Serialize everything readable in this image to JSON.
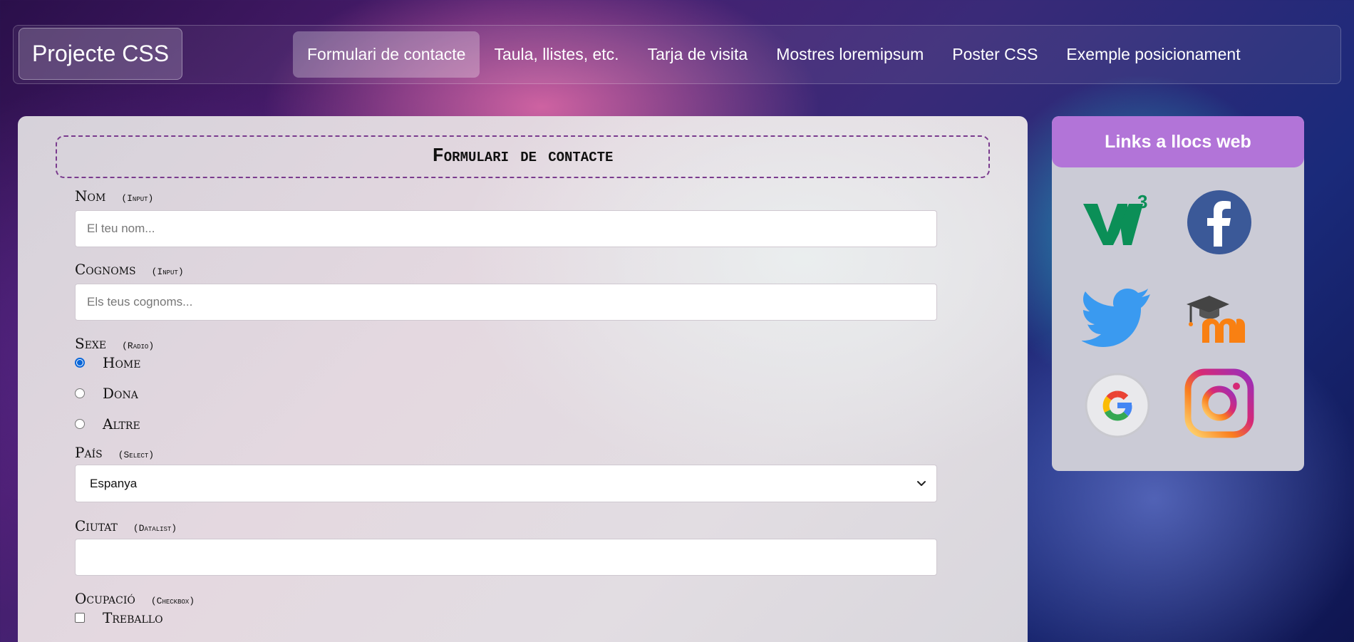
{
  "nav": {
    "brand": "Projecte CSS",
    "items": [
      {
        "label": "Formulari de contacte",
        "active": true
      },
      {
        "label": "Taula, llistes, etc.",
        "active": false
      },
      {
        "label": "Tarja de visita",
        "active": false
      },
      {
        "label": "Mostres loremipsum",
        "active": false
      },
      {
        "label": "Poster CSS",
        "active": false
      },
      {
        "label": "Exemple posicionament",
        "active": false
      }
    ]
  },
  "form": {
    "title": "Formulari de contacte",
    "nom": {
      "label": "Nom",
      "hint": "(Input)",
      "placeholder": "El teu nom...",
      "value": ""
    },
    "cognoms": {
      "label": "Cognoms",
      "hint": "(Input)",
      "placeholder": "Els teus cognoms...",
      "value": ""
    },
    "sexe": {
      "label": "Sexe",
      "hint": "(Radio)",
      "options": [
        {
          "label": "Home",
          "checked": true
        },
        {
          "label": "Dona",
          "checked": false
        },
        {
          "label": "Altre",
          "checked": false
        }
      ]
    },
    "pais": {
      "label": "País",
      "hint": "(Select)",
      "selected": "Espanya"
    },
    "ciutat": {
      "label": "Ciutat",
      "hint": "(Datalist)",
      "value": ""
    },
    "ocupacio": {
      "label": "Ocupació",
      "hint": "(Checkbox)",
      "options": [
        {
          "label": "Treballo",
          "checked": false
        }
      ]
    }
  },
  "sidebar": {
    "title": "Links a llocs web",
    "links": [
      {
        "icon": "w3c-icon"
      },
      {
        "icon": "facebook-icon"
      },
      {
        "icon": "twitter-icon"
      },
      {
        "icon": "moodle-icon"
      },
      {
        "icon": "google-icon"
      },
      {
        "icon": "instagram-icon"
      }
    ]
  },
  "colors": {
    "sidebar_header": "#b274d8",
    "radio_checked": "#0a66d8",
    "form_title_border": "#7a3b8e"
  }
}
